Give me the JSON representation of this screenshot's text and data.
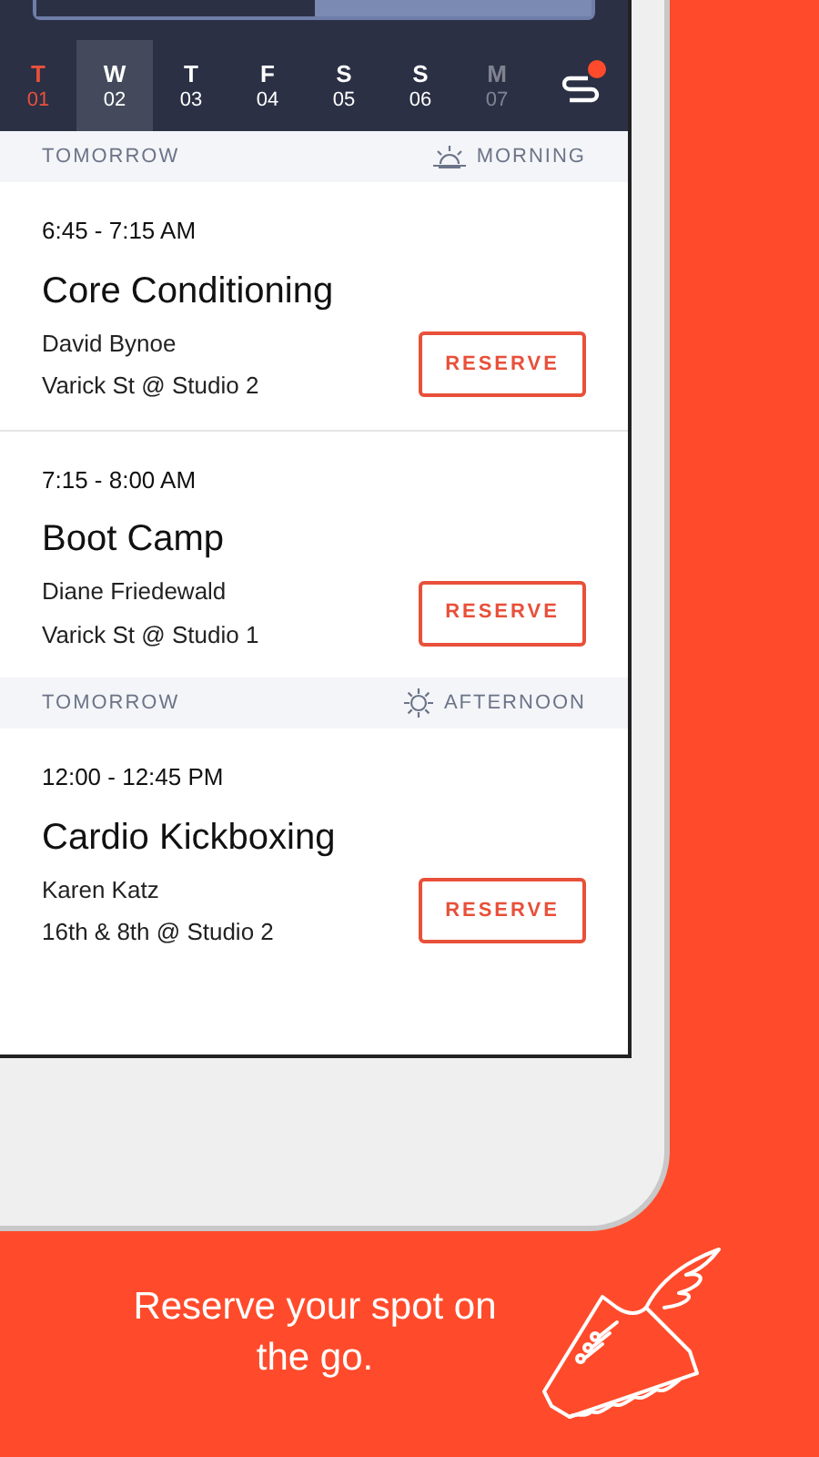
{
  "days": [
    {
      "letter": "T",
      "date": "01",
      "selected": false,
      "today": true,
      "dimmed": false
    },
    {
      "letter": "W",
      "date": "02",
      "selected": true,
      "today": false,
      "dimmed": false
    },
    {
      "letter": "T",
      "date": "03",
      "selected": false,
      "today": false,
      "dimmed": false
    },
    {
      "letter": "F",
      "date": "04",
      "selected": false,
      "today": false,
      "dimmed": false
    },
    {
      "letter": "S",
      "date": "05",
      "selected": false,
      "today": false,
      "dimmed": false
    },
    {
      "letter": "S",
      "date": "06",
      "selected": false,
      "today": false,
      "dimmed": false
    },
    {
      "letter": "M",
      "date": "07",
      "selected": false,
      "today": false,
      "dimmed": true
    }
  ],
  "filter": {
    "badge": true
  },
  "sections": [
    {
      "day": "TOMORROW",
      "period": "MORNING",
      "kind": "morning",
      "classes": [
        {
          "time": "6:45 - 7:15 AM",
          "name": "Core Conditioning",
          "instructor": "David Bynoe",
          "location": "Varick St @ Studio 2",
          "action": "RESERVE"
        },
        {
          "time": "7:15 - 8:00 AM",
          "name": "Boot Camp",
          "instructor": "Diane Friedewald",
          "location": "Varick St @ Studio 1",
          "action": "RESERVE"
        }
      ]
    },
    {
      "day": "TOMORROW",
      "period": "AFTERNOON",
      "kind": "afternoon",
      "classes": [
        {
          "time": "12:00 - 12:45 PM",
          "name": "Cardio Kickboxing",
          "instructor": "Karen Katz",
          "location": "16th & 8th @ Studio 2",
          "action": "RESERVE"
        }
      ]
    }
  ],
  "tagline": "Reserve your spot on the go."
}
